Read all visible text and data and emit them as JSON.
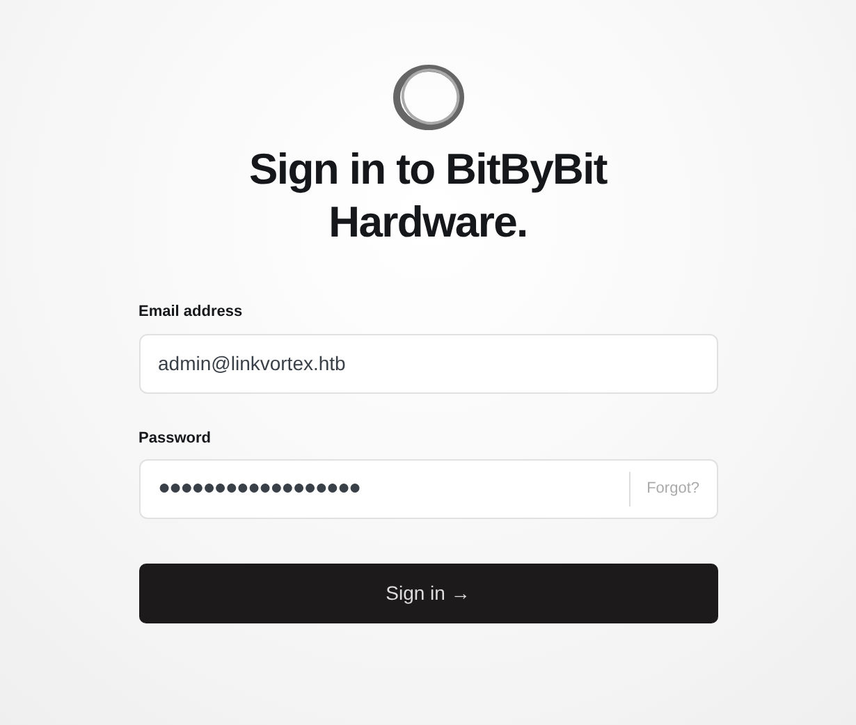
{
  "title": "Sign in to BitByBit Hardware.",
  "email": {
    "label": "Email address",
    "value": "admin@linkvortex.htb"
  },
  "password": {
    "label": "Password",
    "value": "●●●●●●●●●●●●●●●●●●",
    "forgot": "Forgot?"
  },
  "submit": "Sign in →"
}
